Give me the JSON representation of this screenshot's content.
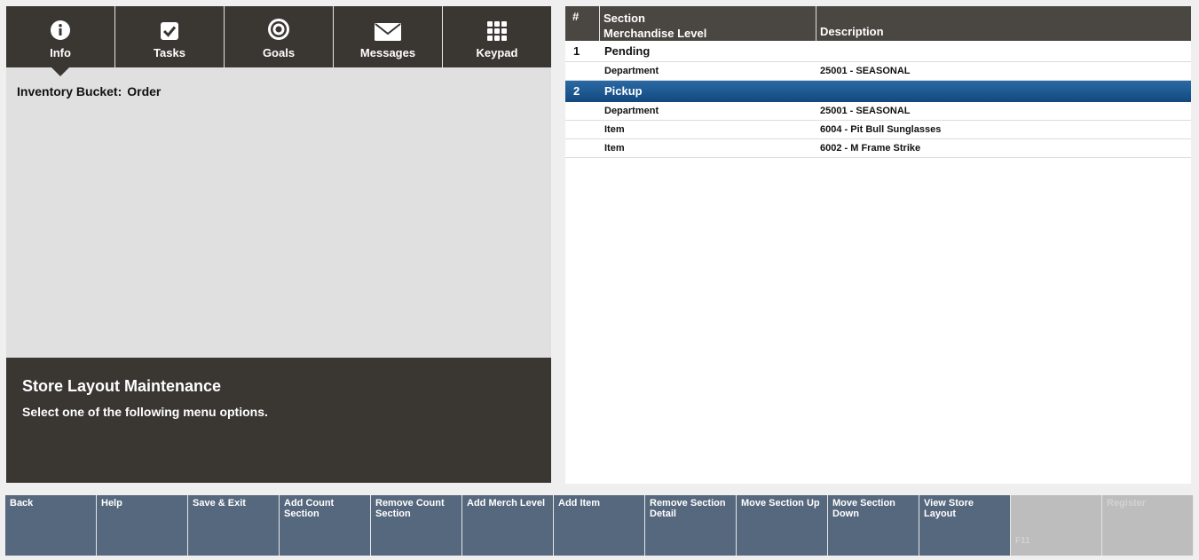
{
  "tabs": [
    {
      "label": "Info",
      "icon": "info-icon"
    },
    {
      "label": "Tasks",
      "icon": "checkbox-icon"
    },
    {
      "label": "Goals",
      "icon": "target-icon"
    },
    {
      "label": "Messages",
      "icon": "envelope-icon"
    },
    {
      "label": "Keypad",
      "icon": "keypad-grid-icon"
    }
  ],
  "info": {
    "bucket_label": "Inventory Bucket:",
    "bucket_value": "Order"
  },
  "message": {
    "title": "Store Layout Maintenance",
    "text": "Select one of the following menu options."
  },
  "table": {
    "headers": {
      "num": "#",
      "section": "Section",
      "merch": "Merchandise Level",
      "desc": "Description"
    },
    "rows": [
      {
        "type": "section",
        "num": "1",
        "name": "Pending",
        "desc": ""
      },
      {
        "type": "detail",
        "num": "",
        "name": "Department",
        "desc": "25001 - SEASONAL"
      },
      {
        "type": "section",
        "num": "2",
        "name": "Pickup",
        "desc": "",
        "selected": true
      },
      {
        "type": "detail",
        "num": "",
        "name": "Department",
        "desc": "25001 - SEASONAL"
      },
      {
        "type": "detail",
        "num": "",
        "name": "Item",
        "desc": "6004 - Pit Bull Sunglasses"
      },
      {
        "type": "detail",
        "num": "",
        "name": "Item",
        "desc": "6002 - M Frame Strike"
      }
    ]
  },
  "buttons": [
    {
      "label": "Back"
    },
    {
      "label": "Help"
    },
    {
      "label": "Save & Exit"
    },
    {
      "label": "Add Count Section"
    },
    {
      "label": "Remove Count Section"
    },
    {
      "label": "Add Merch Level"
    },
    {
      "label": "Add Item"
    },
    {
      "label": "Remove Section Detail"
    },
    {
      "label": "Move Section Up"
    },
    {
      "label": "Move Section Down"
    },
    {
      "label": "View Store Layout"
    },
    {
      "label": "",
      "sub": "F11",
      "disabled": true
    },
    {
      "label": "Register",
      "disabled": true
    }
  ],
  "colors": {
    "dark_panel": "#3a3632",
    "button_blue": "#56687e",
    "selected_row": "#1f5a95"
  }
}
